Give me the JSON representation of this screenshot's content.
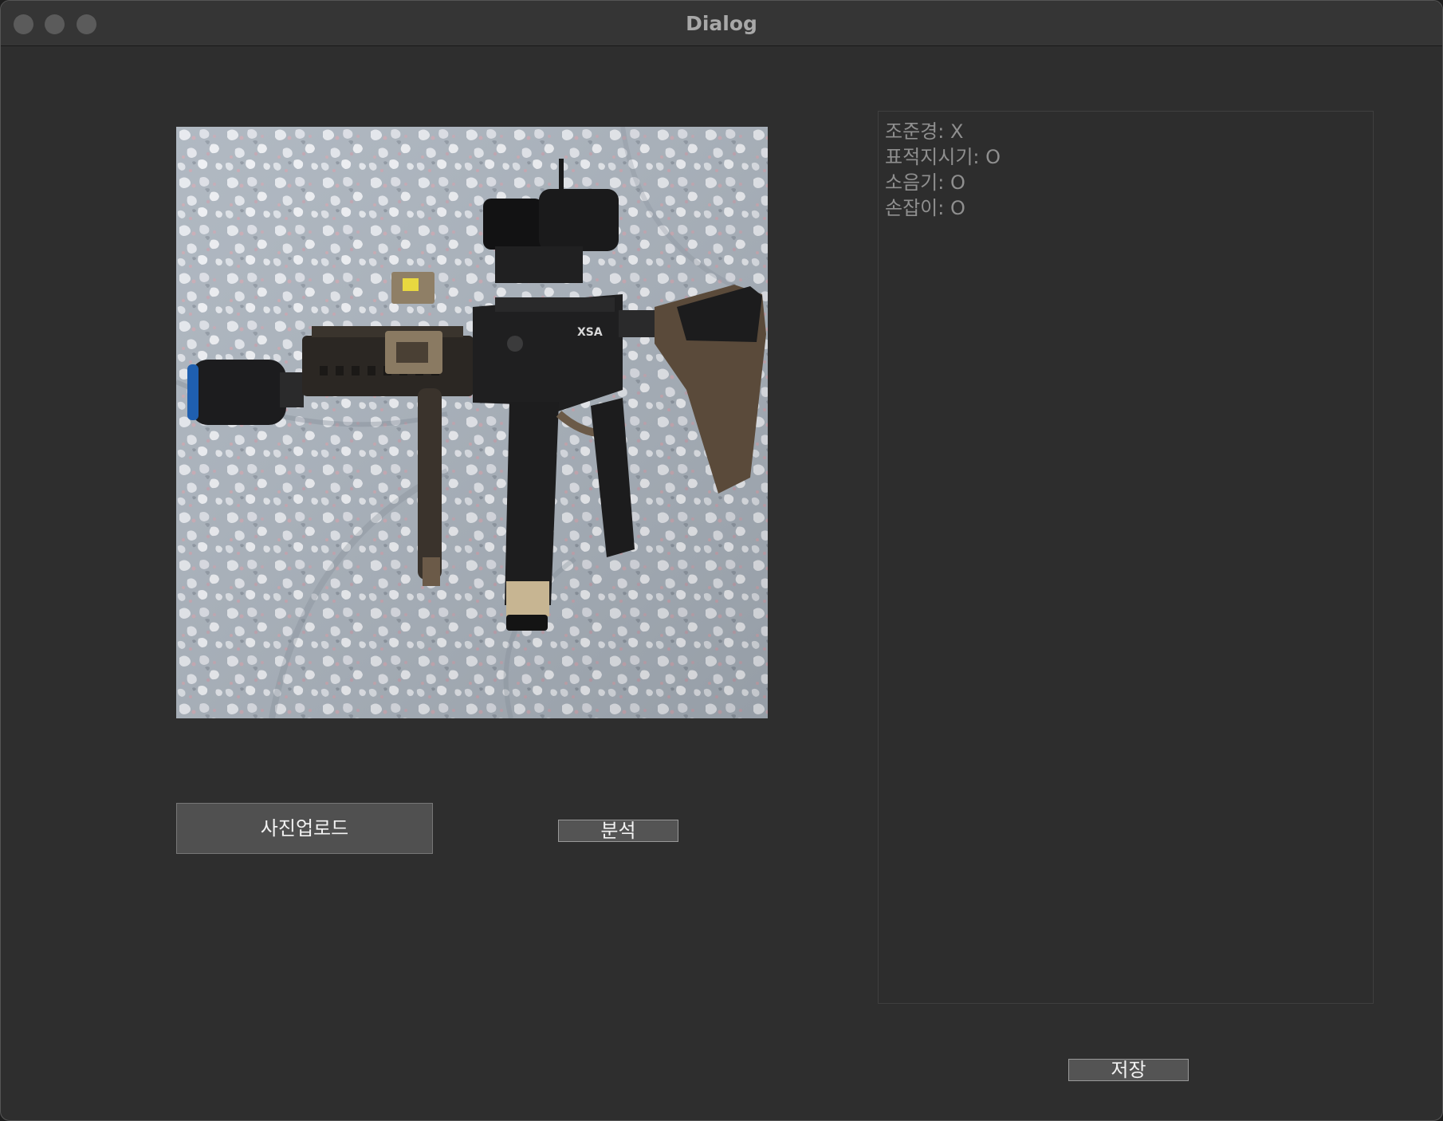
{
  "window": {
    "title": "Dialog"
  },
  "photo": {
    "label": "XSA"
  },
  "buttons": {
    "upload": "사진업로드",
    "analyze": "분석",
    "save": "저장"
  },
  "result": {
    "lines": [
      "조준경: X",
      "표적지시기: O",
      "소음기: O",
      "손잡이: O"
    ]
  },
  "colors": {
    "window_bg": "#2e2e2e",
    "titlebar_bg": "#353535",
    "button_bg": "#505050",
    "result_text": "#8f8f8f"
  }
}
